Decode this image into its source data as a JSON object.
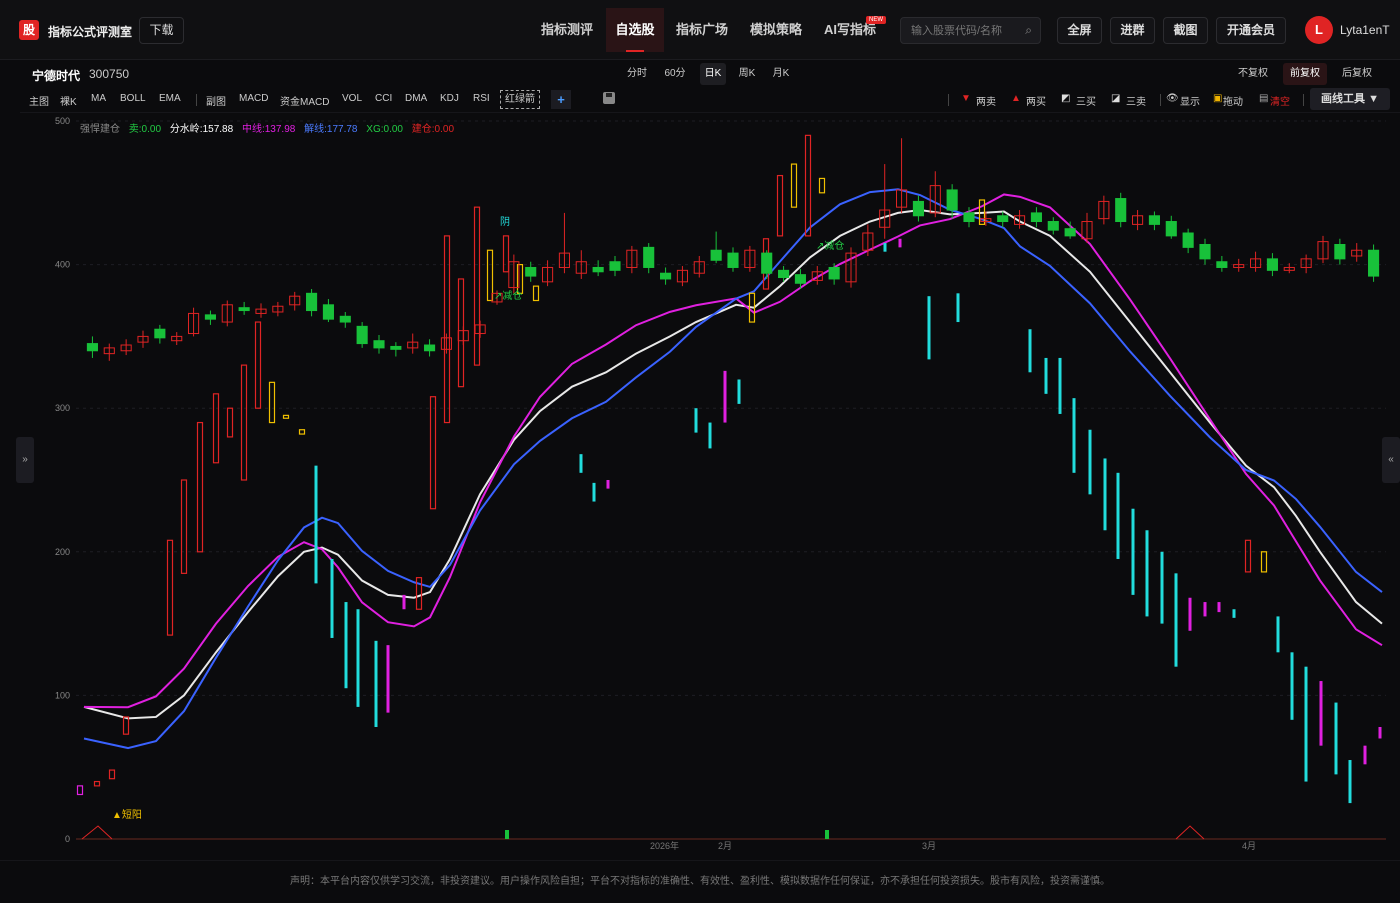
{
  "header": {
    "logo_char": "股",
    "app_title": "指标公式评测室",
    "download_label": "下载",
    "nav": [
      "指标测评",
      "自选股",
      "指标广场",
      "模拟策略",
      "AI写指标"
    ],
    "nav_active_index": 1,
    "new_badge": "NEW",
    "search_placeholder": "输入股票代码/名称",
    "buttons": [
      "全屏",
      "进群",
      "截图",
      "开通会员"
    ],
    "user_initial": "L",
    "user_name": "Lyta1enT"
  },
  "stock": {
    "name": "宁德时代",
    "code": "300750"
  },
  "periods": [
    "分时",
    "60分",
    "日K",
    "周K",
    "月K"
  ],
  "period_active": "日K",
  "adjust": [
    "不复权",
    "前复权",
    "后复权"
  ],
  "adjust_active": "前复权",
  "toolbar": {
    "main_label": "主图",
    "main_items": [
      "裸K",
      "MA",
      "BOLL",
      "EMA"
    ],
    "sub_label": "副图",
    "sub_items": [
      "MACD",
      "资金MACD",
      "VOL",
      "CCI",
      "DMA",
      "KDJ",
      "RSI"
    ],
    "hongluo": "红绿箭",
    "plus": "+",
    "right_items": [
      "两卖",
      "两买",
      "三买",
      "三卖",
      "显示",
      "拖动",
      "清空"
    ],
    "draw_tools": "画线工具 ▼"
  },
  "legend": {
    "name": "强悍建仓",
    "sell": "卖:0.00",
    "fsl": "分水岭:157.88",
    "mid": "中线:137.98",
    "brk": "解线:177.78",
    "xg": "XG:0.00",
    "jc": "建仓:0.00"
  },
  "chart_data": {
    "type": "candlestick",
    "y_ticks": [
      0,
      100,
      200,
      300,
      400,
      500
    ],
    "ylim": [
      0,
      500
    ],
    "x_labels": [
      "2026年",
      "2月",
      "3月",
      "4月"
    ],
    "annotations": [
      "阴",
      "减仓",
      "减仓",
      "短阳"
    ],
    "candles": [
      {
        "o": 345,
        "c": 340,
        "h": 350,
        "l": 335
      },
      {
        "o": 338,
        "c": 342,
        "h": 345,
        "l": 333
      },
      {
        "o": 340,
        "c": 344,
        "h": 348,
        "l": 337
      },
      {
        "o": 346,
        "c": 350,
        "h": 354,
        "l": 342
      },
      {
        "o": 355,
        "c": 349,
        "h": 358,
        "l": 345
      },
      {
        "o": 347,
        "c": 350,
        "h": 353,
        "l": 344
      },
      {
        "o": 352,
        "c": 366,
        "h": 370,
        "l": 350
      },
      {
        "o": 365,
        "c": 362,
        "h": 368,
        "l": 358
      },
      {
        "o": 360,
        "c": 372,
        "h": 375,
        "l": 357
      },
      {
        "o": 370,
        "c": 368,
        "h": 374,
        "l": 365
      },
      {
        "o": 366,
        "c": 369,
        "h": 373,
        "l": 363
      },
      {
        "o": 367,
        "c": 371,
        "h": 374,
        "l": 364
      },
      {
        "o": 372,
        "c": 378,
        "h": 381,
        "l": 368
      },
      {
        "o": 380,
        "c": 368,
        "h": 383,
        "l": 364
      },
      {
        "o": 372,
        "c": 362,
        "h": 376,
        "l": 360
      },
      {
        "o": 364,
        "c": 360,
        "h": 367,
        "l": 356
      },
      {
        "o": 357,
        "c": 345,
        "h": 360,
        "l": 342
      },
      {
        "o": 347,
        "c": 342,
        "h": 351,
        "l": 338
      },
      {
        "o": 343,
        "c": 341,
        "h": 346,
        "l": 336
      },
      {
        "o": 342,
        "c": 346,
        "h": 352,
        "l": 338
      },
      {
        "o": 344,
        "c": 340,
        "h": 348,
        "l": 336
      },
      {
        "o": 341,
        "c": 349,
        "h": 352,
        "l": 338
      },
      {
        "o": 347,
        "c": 354,
        "h": 357,
        "l": 344
      },
      {
        "o": 352,
        "c": 358,
        "h": 361,
        "l": 349
      },
      {
        "o": 374,
        "c": 380,
        "h": 382,
        "l": 372
      },
      {
        "o": 384,
        "c": 402,
        "h": 407,
        "l": 380
      },
      {
        "o": 398,
        "c": 392,
        "h": 402,
        "l": 388
      },
      {
        "o": 388,
        "c": 398,
        "h": 403,
        "l": 385
      },
      {
        "o": 398,
        "c": 408,
        "h": 436,
        "l": 394
      },
      {
        "o": 394,
        "c": 402,
        "h": 410,
        "l": 390
      },
      {
        "o": 398,
        "c": 395,
        "h": 403,
        "l": 392
      },
      {
        "o": 402,
        "c": 396,
        "h": 406,
        "l": 392
      },
      {
        "o": 398,
        "c": 410,
        "h": 413,
        "l": 394
      },
      {
        "o": 412,
        "c": 398,
        "h": 415,
        "l": 394
      },
      {
        "o": 394,
        "c": 390,
        "h": 398,
        "l": 386
      },
      {
        "o": 388,
        "c": 396,
        "h": 399,
        "l": 385
      },
      {
        "o": 394,
        "c": 402,
        "h": 406,
        "l": 391
      },
      {
        "o": 410,
        "c": 403,
        "h": 423,
        "l": 401
      },
      {
        "o": 408,
        "c": 398,
        "h": 412,
        "l": 395
      },
      {
        "o": 398,
        "c": 410,
        "h": 413,
        "l": 395
      },
      {
        "o": 408,
        "c": 394,
        "h": 410,
        "l": 390
      },
      {
        "o": 396,
        "c": 391,
        "h": 399,
        "l": 388
      },
      {
        "o": 393,
        "c": 387,
        "h": 397,
        "l": 383
      },
      {
        "o": 389,
        "c": 395,
        "h": 399,
        "l": 386
      },
      {
        "o": 398,
        "c": 390,
        "h": 401,
        "l": 386
      },
      {
        "o": 388,
        "c": 408,
        "h": 412,
        "l": 384
      },
      {
        "o": 410,
        "c": 422,
        "h": 428,
        "l": 406
      },
      {
        "o": 426,
        "c": 438,
        "h": 470,
        "l": 418
      },
      {
        "o": 440,
        "c": 452,
        "h": 488,
        "l": 436
      },
      {
        "o": 444,
        "c": 434,
        "h": 448,
        "l": 430
      },
      {
        "o": 436,
        "c": 455,
        "h": 465,
        "l": 433
      },
      {
        "o": 452,
        "c": 438,
        "h": 456,
        "l": 432
      },
      {
        "o": 436,
        "c": 430,
        "h": 440,
        "l": 426
      },
      {
        "o": 430,
        "c": 432,
        "h": 437,
        "l": 427
      },
      {
        "o": 434,
        "c": 430,
        "h": 437,
        "l": 426
      },
      {
        "o": 428,
        "c": 434,
        "h": 438,
        "l": 425
      },
      {
        "o": 436,
        "c": 430,
        "h": 440,
        "l": 426
      },
      {
        "o": 430,
        "c": 424,
        "h": 433,
        "l": 421
      },
      {
        "o": 425,
        "c": 420,
        "h": 430,
        "l": 418
      },
      {
        "o": 418,
        "c": 430,
        "h": 436,
        "l": 415
      },
      {
        "o": 432,
        "c": 444,
        "h": 448,
        "l": 428
      },
      {
        "o": 446,
        "c": 430,
        "h": 450,
        "l": 426
      },
      {
        "o": 428,
        "c": 434,
        "h": 438,
        "l": 424
      },
      {
        "o": 434,
        "c": 428,
        "h": 437,
        "l": 424
      },
      {
        "o": 430,
        "c": 420,
        "h": 434,
        "l": 418
      },
      {
        "o": 422,
        "c": 412,
        "h": 425,
        "l": 408
      },
      {
        "o": 414,
        "c": 404,
        "h": 418,
        "l": 400
      },
      {
        "o": 402,
        "c": 398,
        "h": 406,
        "l": 395
      },
      {
        "o": 398,
        "c": 400,
        "h": 404,
        "l": 395
      },
      {
        "o": 398,
        "c": 404,
        "h": 409,
        "l": 395
      },
      {
        "o": 404,
        "c": 396,
        "h": 408,
        "l": 392
      },
      {
        "o": 396,
        "c": 398,
        "h": 401,
        "l": 394
      },
      {
        "o": 398,
        "c": 404,
        "h": 407,
        "l": 394
      },
      {
        "o": 404,
        "c": 416,
        "h": 420,
        "l": 401
      },
      {
        "o": 414,
        "c": 404,
        "h": 418,
        "l": 400
      },
      {
        "o": 406,
        "c": 410,
        "h": 415,
        "l": 402
      },
      {
        "o": 410,
        "c": 392,
        "h": 414,
        "l": 388
      }
    ]
  }
}
